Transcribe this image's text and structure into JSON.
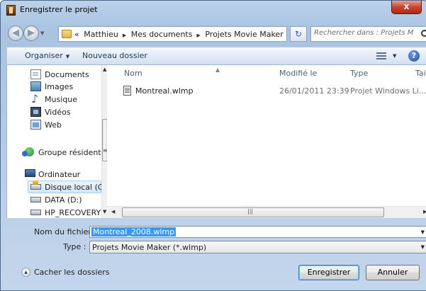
{
  "window": {
    "title": "Enregistrer le projet",
    "close_label": "x"
  },
  "address_bar": {
    "overflow": "«",
    "crumbs": [
      "Matthieu",
      "Mes documents",
      "Projets Movie Maker"
    ],
    "separator": "▶",
    "search_placeholder": "Rechercher dans : Projets Movi..."
  },
  "toolbar": {
    "organise_label": "Organiser",
    "new_folder_label": "Nouveau dossier"
  },
  "nav_pane": {
    "items": [
      {
        "label": "Documents",
        "icon": "document-icon"
      },
      {
        "label": "Images",
        "icon": "images-icon"
      },
      {
        "label": "Musique",
        "icon": "music-icon"
      },
      {
        "label": "Vidéos",
        "icon": "videos-icon"
      },
      {
        "label": "Web",
        "icon": "web-icon"
      },
      {
        "label": "Groupe résidentiel",
        "icon": "homegroup-icon"
      },
      {
        "label": "Ordinateur",
        "icon": "computer-icon"
      },
      {
        "label": "Disque local (C:)",
        "icon": "local-disk-icon",
        "selected": true
      },
      {
        "label": "DATA (D:)",
        "icon": "drive-icon"
      },
      {
        "label": "HP_RECOVERY (E",
        "icon": "drive-icon"
      }
    ]
  },
  "file_list": {
    "columns": [
      "Nom",
      "Modifié le",
      "Type",
      "Tail"
    ],
    "rows": [
      {
        "name": "Montreal.wlmp",
        "modified": "26/01/2011 23:39",
        "type": "Projet Windows Li..."
      }
    ]
  },
  "form": {
    "filename_label": "Nom du fichier :",
    "filename_value": "Montreal_2008.wlmp",
    "type_label": "Type :",
    "type_value": "Projets Movie Maker (*.wlmp)"
  },
  "footer": {
    "hide_folders_label": "Cacher les dossiers",
    "save_label": "Enregistrer",
    "cancel_label": "Annuler"
  },
  "colors": {
    "selection": "#3399ff",
    "toolbar_text": "#1e395b",
    "close_button": "#c7442d"
  }
}
